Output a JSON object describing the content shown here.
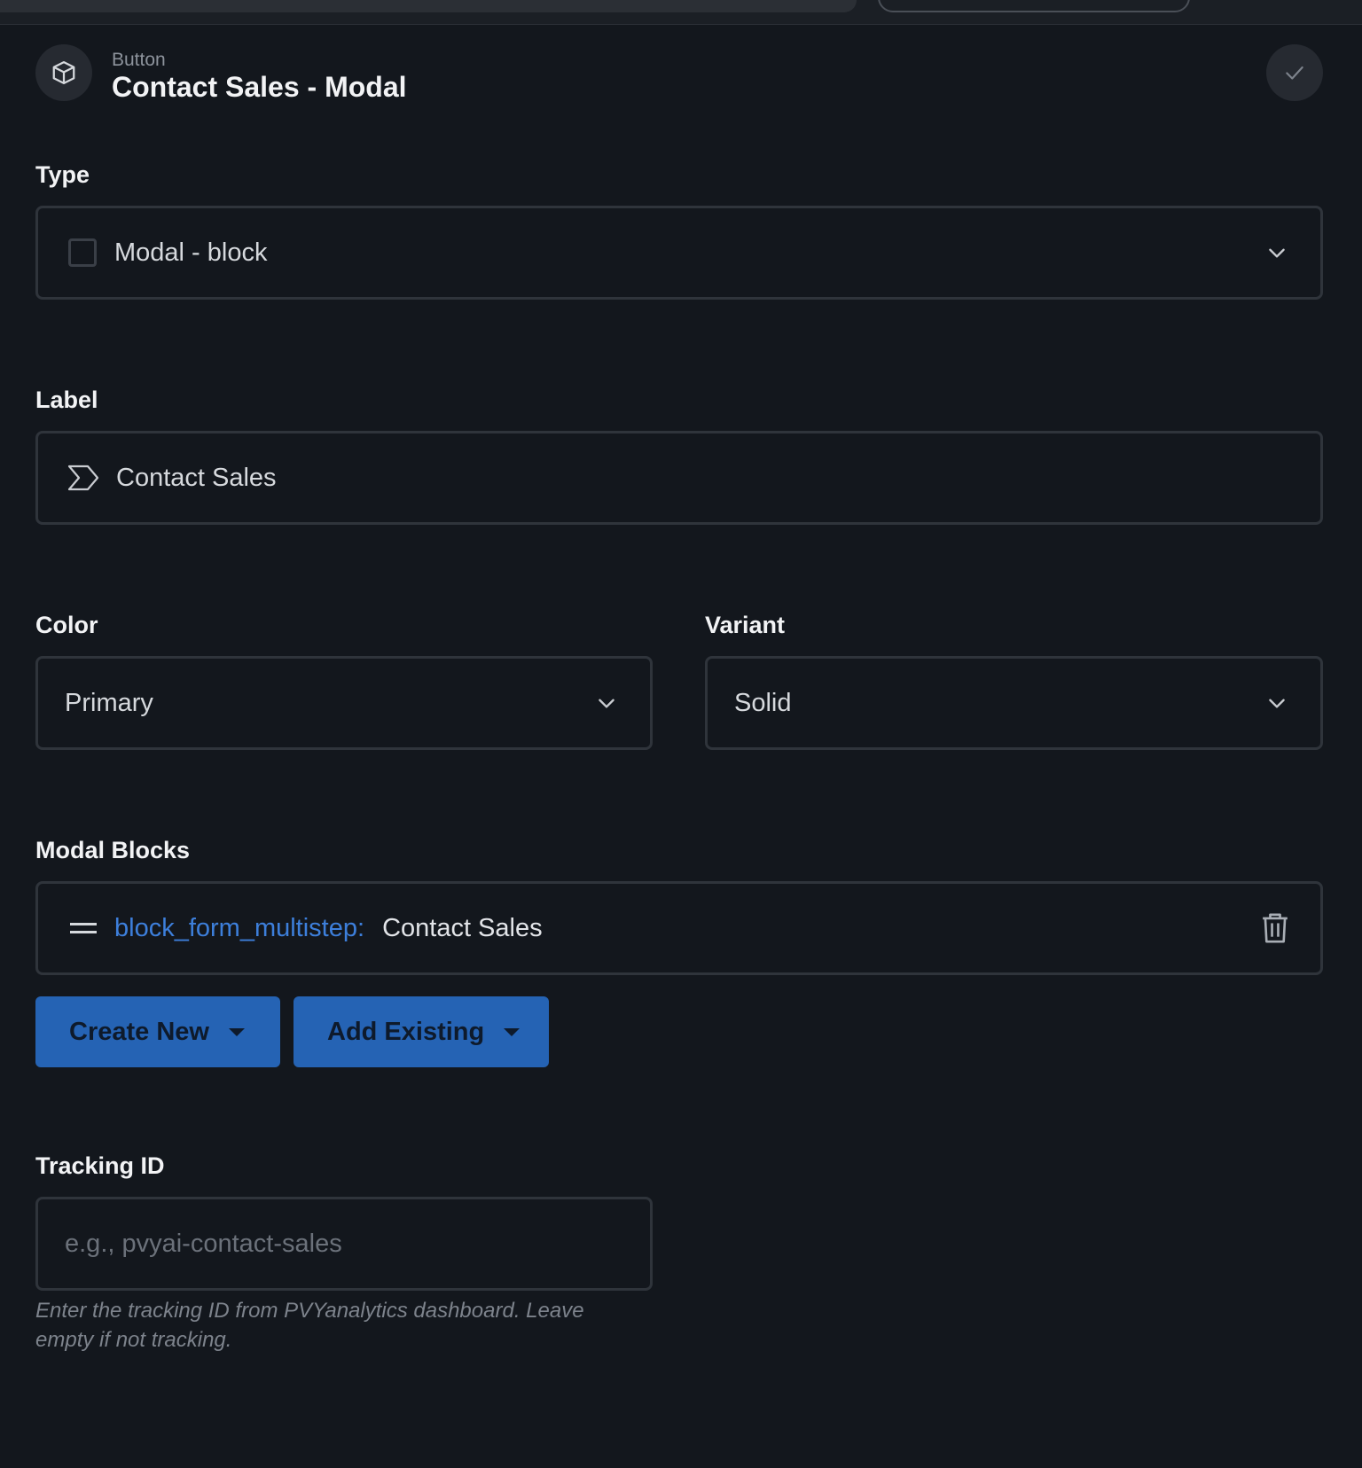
{
  "header": {
    "kind": "Button",
    "title": "Contact Sales - Modal"
  },
  "type_field": {
    "label": "Type",
    "value": "Modal - block"
  },
  "label_field": {
    "label": "Label",
    "value": "Contact Sales"
  },
  "color_field": {
    "label": "Color",
    "value": "Primary"
  },
  "variant_field": {
    "label": "Variant",
    "value": "Solid"
  },
  "modal_blocks": {
    "label": "Modal Blocks",
    "items": [
      {
        "type": "block_form_multistep:",
        "name": "Contact Sales"
      }
    ],
    "create_new_label": "Create New",
    "add_existing_label": "Add Existing"
  },
  "tracking": {
    "label": "Tracking ID",
    "placeholder": "e.g., pvyai-contact-sales",
    "helper": "Enter the tracking ID from PVYanalytics dashboard. Leave empty if not tracking."
  },
  "colors": {
    "background": "#13171d",
    "accent": "#2563b4",
    "link": "#3d7fdb"
  }
}
